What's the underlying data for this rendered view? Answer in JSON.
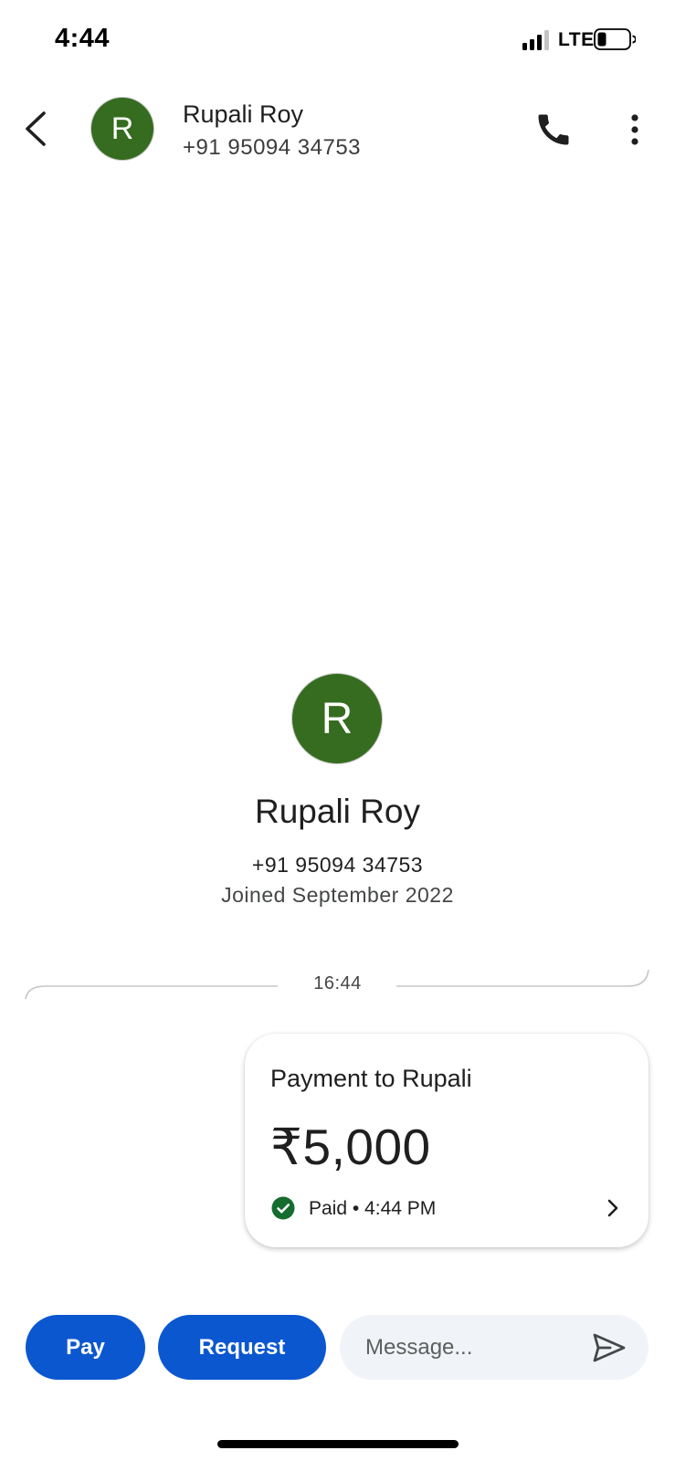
{
  "status_bar": {
    "time": "4:44",
    "network": "LTE",
    "icons": [
      "signal-icon",
      "battery-icon"
    ]
  },
  "header": {
    "avatar_initial": "R",
    "contact_name": "Rupali Roy",
    "contact_phone": "+91 95094 34753",
    "icons": [
      "back-arrow-icon",
      "phone-icon",
      "more-vert-icon"
    ]
  },
  "profile": {
    "avatar_initial": "R",
    "name": "Rupali Roy",
    "phone": "+91 95094 34753",
    "joined": "Joined September 2022"
  },
  "conversation": {
    "divider_time": "16:44",
    "payment_card": {
      "title": "Payment to Rupali",
      "amount": "₹5,000",
      "status": "Paid • 4:44 PM",
      "status_icon": "check-circle-icon"
    }
  },
  "bottom_bar": {
    "pay_label": "Pay",
    "request_label": "Request",
    "message_placeholder": "Message...",
    "send_icon": "send-icon"
  },
  "colors": {
    "avatar_green": "#356c1f",
    "button_blue": "#0b57d0",
    "paid_green": "#146c2e",
    "message_bg": "#f0f4f9"
  }
}
